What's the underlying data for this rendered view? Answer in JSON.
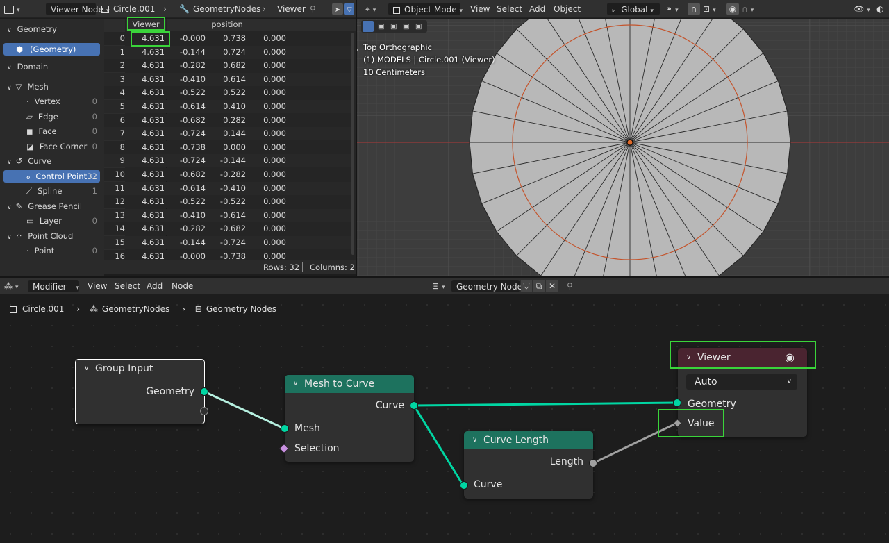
{
  "spreadsheet_header": {
    "editor_type": "Viewer Node",
    "object": "Circle.001",
    "modifier": "GeometryNodes",
    "node": "Viewer"
  },
  "viewport_header": {
    "mode": "Object Mode",
    "menus": [
      "View",
      "Select",
      "Add",
      "Object"
    ],
    "orientation": "Global"
  },
  "left_panel": {
    "geometry_label": "Geometry",
    "geometry_item": "(Geometry)",
    "domain_label": "Domain",
    "items": [
      {
        "label": "Mesh",
        "count": ""
      },
      {
        "label": "Vertex",
        "count": "0"
      },
      {
        "label": "Edge",
        "count": "0"
      },
      {
        "label": "Face",
        "count": "0"
      },
      {
        "label": "Face Corner",
        "count": "0"
      },
      {
        "label": "Curve",
        "count": ""
      },
      {
        "label": "Control Point",
        "count": "32"
      },
      {
        "label": "Spline",
        "count": "1"
      },
      {
        "label": "Grease Pencil",
        "count": ""
      },
      {
        "label": "Layer",
        "count": "0"
      },
      {
        "label": "Point Cloud",
        "count": ""
      },
      {
        "label": "Point",
        "count": "0"
      }
    ]
  },
  "spreadsheet": {
    "columns": [
      "Viewer",
      "position"
    ],
    "rows": [
      [
        "0",
        "4.631",
        "-0.000",
        "0.738",
        "0.000"
      ],
      [
        "1",
        "4.631",
        "-0.144",
        "0.724",
        "0.000"
      ],
      [
        "2",
        "4.631",
        "-0.282",
        "0.682",
        "0.000"
      ],
      [
        "3",
        "4.631",
        "-0.410",
        "0.614",
        "0.000"
      ],
      [
        "4",
        "4.631",
        "-0.522",
        "0.522",
        "0.000"
      ],
      [
        "5",
        "4.631",
        "-0.614",
        "0.410",
        "0.000"
      ],
      [
        "6",
        "4.631",
        "-0.682",
        "0.282",
        "0.000"
      ],
      [
        "7",
        "4.631",
        "-0.724",
        "0.144",
        "0.000"
      ],
      [
        "8",
        "4.631",
        "-0.738",
        "0.000",
        "0.000"
      ],
      [
        "9",
        "4.631",
        "-0.724",
        "-0.144",
        "0.000"
      ],
      [
        "10",
        "4.631",
        "-0.682",
        "-0.282",
        "0.000"
      ],
      [
        "11",
        "4.631",
        "-0.614",
        "-0.410",
        "0.000"
      ],
      [
        "12",
        "4.631",
        "-0.522",
        "-0.522",
        "0.000"
      ],
      [
        "13",
        "4.631",
        "-0.410",
        "-0.614",
        "0.000"
      ],
      [
        "14",
        "4.631",
        "-0.282",
        "-0.682",
        "0.000"
      ],
      [
        "15",
        "4.631",
        "-0.144",
        "-0.724",
        "0.000"
      ],
      [
        "16",
        "4.631",
        "-0.000",
        "-0.738",
        "0.000"
      ]
    ],
    "rows_label": "Rows: 32",
    "columns_label": "Columns: 2"
  },
  "viewport": {
    "view_name": "Top Orthographic",
    "collection": "(1) MODELS | Circle.001 (Viewer)",
    "scale": "10 Centimeters"
  },
  "node_header": {
    "mode": "Modifier",
    "menus": [
      "View",
      "Select",
      "Add",
      "Node"
    ],
    "tree_name": "Geometry Nodes",
    "breadcrumb": [
      "Circle.001",
      "GeometryNodes",
      "Geometry Nodes"
    ]
  },
  "nodes": {
    "group_input": {
      "title": "Group Input",
      "out_geometry": "Geometry"
    },
    "mesh_to_curve": {
      "title": "Mesh to Curve",
      "out_curve": "Curve",
      "in_mesh": "Mesh",
      "in_selection": "Selection"
    },
    "curve_length": {
      "title": "Curve Length",
      "out_length": "Length",
      "in_curve": "Curve"
    },
    "viewer": {
      "title": "Viewer",
      "domain": "Auto",
      "in_geometry": "Geometry",
      "in_value": "Value"
    }
  },
  "colors": {
    "geometry_socket": "#00d6a3",
    "mesh_to_curve_header": "#1d725e",
    "viewer_header": "#4a2430",
    "selection": "#4772b3",
    "highlight": "#3ad43a"
  }
}
